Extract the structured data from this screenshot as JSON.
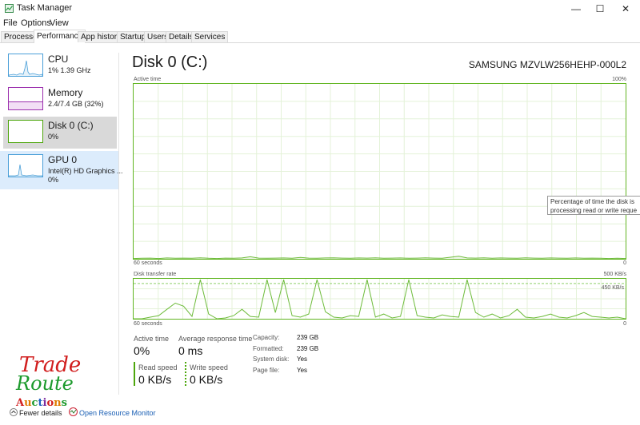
{
  "window": {
    "title": "Task Manager",
    "minimize": "—",
    "maximize": "☐",
    "close": "✕"
  },
  "menu": [
    {
      "label": "File"
    },
    {
      "label": "Options"
    },
    {
      "label": "View"
    }
  ],
  "tabs": [
    {
      "label": "Processes"
    },
    {
      "label": "Performance"
    },
    {
      "label": "App history"
    },
    {
      "label": "Startup"
    },
    {
      "label": "Users"
    },
    {
      "label": "Details"
    },
    {
      "label": "Services"
    }
  ],
  "sidebar": [
    {
      "name": "CPU",
      "line1": "1%  1.39 GHz",
      "color": "#4a9fd8"
    },
    {
      "name": "Memory",
      "line1": "2.4/7.4 GB (32%)",
      "color": "#9b2fae"
    },
    {
      "name": "Disk 0 (C:)",
      "line1": "0%",
      "color": "#4da60c"
    },
    {
      "name": "GPU 0",
      "line1": "Intel(R) HD Graphics ...",
      "line2": "0%",
      "color": "#4a9fd8"
    }
  ],
  "main": {
    "title": "Disk 0 (C:)",
    "model": "SAMSUNG MZVLW256HEHP-000L2",
    "graph1": {
      "label": "Active time",
      "max": "100%",
      "time": "60 seconds",
      "min": "0"
    },
    "graph2": {
      "label": "Disk transfer rate",
      "max": "500 KB/s",
      "mid": "450 KB/s",
      "time": "60 seconds",
      "min": "0"
    },
    "tooltip": {
      "line1": "Percentage of time the disk is",
      "line2": "processing read or write reque"
    }
  },
  "stats": {
    "active_time": {
      "label": "Active time",
      "value": "0%"
    },
    "avg_response": {
      "label": "Average response time",
      "value": "0 ms"
    },
    "read_speed": {
      "label": "Read speed",
      "value": "0 KB/s"
    },
    "write_speed": {
      "label": "Write speed",
      "value": "0 KB/s"
    },
    "info": [
      {
        "label": "Capacity:",
        "value": "239 GB"
      },
      {
        "label": "Formatted:",
        "value": "239 GB"
      },
      {
        "label": "System disk:",
        "value": "Yes"
      },
      {
        "label": "Page file:",
        "value": "Yes"
      }
    ]
  },
  "footer": {
    "fewer_details": "Fewer details",
    "open_resource_monitor": "Open Resource Monitor"
  },
  "watermark": {
    "line1": "Trade",
    "line2": "Route",
    "line3": "Auctions"
  },
  "activity": {
    "active_time_pct": [
      0.2,
      0.3,
      0.4,
      0.2,
      0.5,
      0.3,
      0.4,
      0.3,
      0.6,
      0.3,
      0.2,
      0.4,
      0.3,
      0.5,
      1.2,
      0.4,
      0.3,
      0.4,
      0.5,
      0.3,
      0.8,
      0.4,
      0.3,
      0.5,
      0.6,
      0.4,
      0.3,
      0.5,
      0.4,
      0.6,
      0.3,
      0.4,
      0.5,
      0.3,
      0.4,
      0.6,
      0.4,
      0.3,
      0.9,
      1.5,
      0.5,
      0.4,
      0.6,
      0.3,
      0.5,
      0.4,
      0.3,
      0.6,
      0.4,
      0.3,
      0.5,
      0.4,
      0.3,
      0.5,
      0.3,
      0.4,
      0.3,
      0.2,
      0.3,
      0.2
    ],
    "transfer_kbps": [
      0,
      0,
      20,
      40,
      120,
      200,
      160,
      30,
      500,
      60,
      0,
      10,
      40,
      120,
      30,
      20,
      500,
      80,
      500,
      40,
      20,
      60,
      500,
      90,
      20,
      10,
      40,
      30,
      500,
      20,
      60,
      10,
      30,
      500,
      40,
      20,
      10,
      50,
      30,
      20,
      500,
      80,
      20,
      60,
      10,
      40,
      120,
      20,
      10,
      30,
      60,
      20,
      10,
      40,
      80,
      30,
      20,
      10,
      20,
      0
    ]
  }
}
